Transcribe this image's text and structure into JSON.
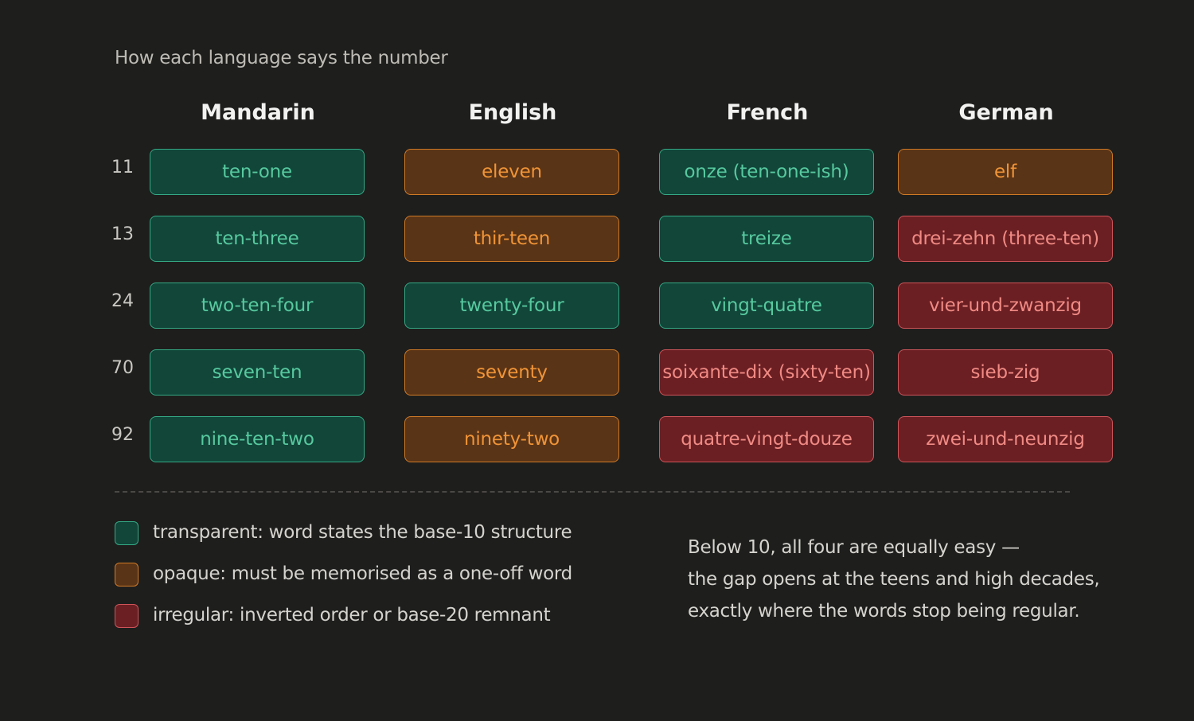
{
  "subtitle": "How each language says the number",
  "columns": [
    "Mandarin",
    "English",
    "French",
    "German"
  ],
  "rows": [
    {
      "number": "11",
      "cells": [
        {
          "text": "ten-one",
          "kind": "transparent"
        },
        {
          "text": "eleven",
          "kind": "opaque"
        },
        {
          "text": "onze (ten-one-ish)",
          "kind": "transparent"
        },
        {
          "text": "elf",
          "kind": "opaque"
        }
      ]
    },
    {
      "number": "13",
      "cells": [
        {
          "text": "ten-three",
          "kind": "transparent"
        },
        {
          "text": "thir-teen",
          "kind": "opaque"
        },
        {
          "text": "treize",
          "kind": "transparent"
        },
        {
          "text": "drei-zehn (three-ten)",
          "kind": "irregular"
        }
      ]
    },
    {
      "number": "24",
      "cells": [
        {
          "text": "two-ten-four",
          "kind": "transparent"
        },
        {
          "text": "twenty-four",
          "kind": "transparent"
        },
        {
          "text": "vingt-quatre",
          "kind": "transparent"
        },
        {
          "text": "vier-und-zwanzig",
          "kind": "irregular"
        }
      ]
    },
    {
      "number": "70",
      "cells": [
        {
          "text": "seven-ten",
          "kind": "transparent"
        },
        {
          "text": "seventy",
          "kind": "opaque"
        },
        {
          "text": "soixante-dix (sixty-ten)",
          "kind": "irregular"
        },
        {
          "text": "sieb-zig",
          "kind": "irregular"
        }
      ]
    },
    {
      "number": "92",
      "cells": [
        {
          "text": "nine-ten-two",
          "kind": "transparent"
        },
        {
          "text": "ninety-two",
          "kind": "opaque"
        },
        {
          "text": "quatre-vingt-douze",
          "kind": "irregular"
        },
        {
          "text": "zwei-und-neunzig",
          "kind": "irregular"
        }
      ]
    }
  ],
  "legend": [
    {
      "kind": "transparent",
      "label": "transparent: word states the base-10 structure"
    },
    {
      "kind": "opaque",
      "label": "opaque: must be memorised as a one-off word"
    },
    {
      "kind": "irregular",
      "label": "irregular: inverted order or base-20 remnant"
    }
  ],
  "note": [
    "Below 10, all four are equally easy —",
    "the gap opens at the teens and high decades,",
    "exactly where the words stop being regular."
  ],
  "colors": {
    "transparent": "#114639",
    "opaque": "#5a3416",
    "irregular": "#6b1f23",
    "background": "#1e1e1d"
  }
}
